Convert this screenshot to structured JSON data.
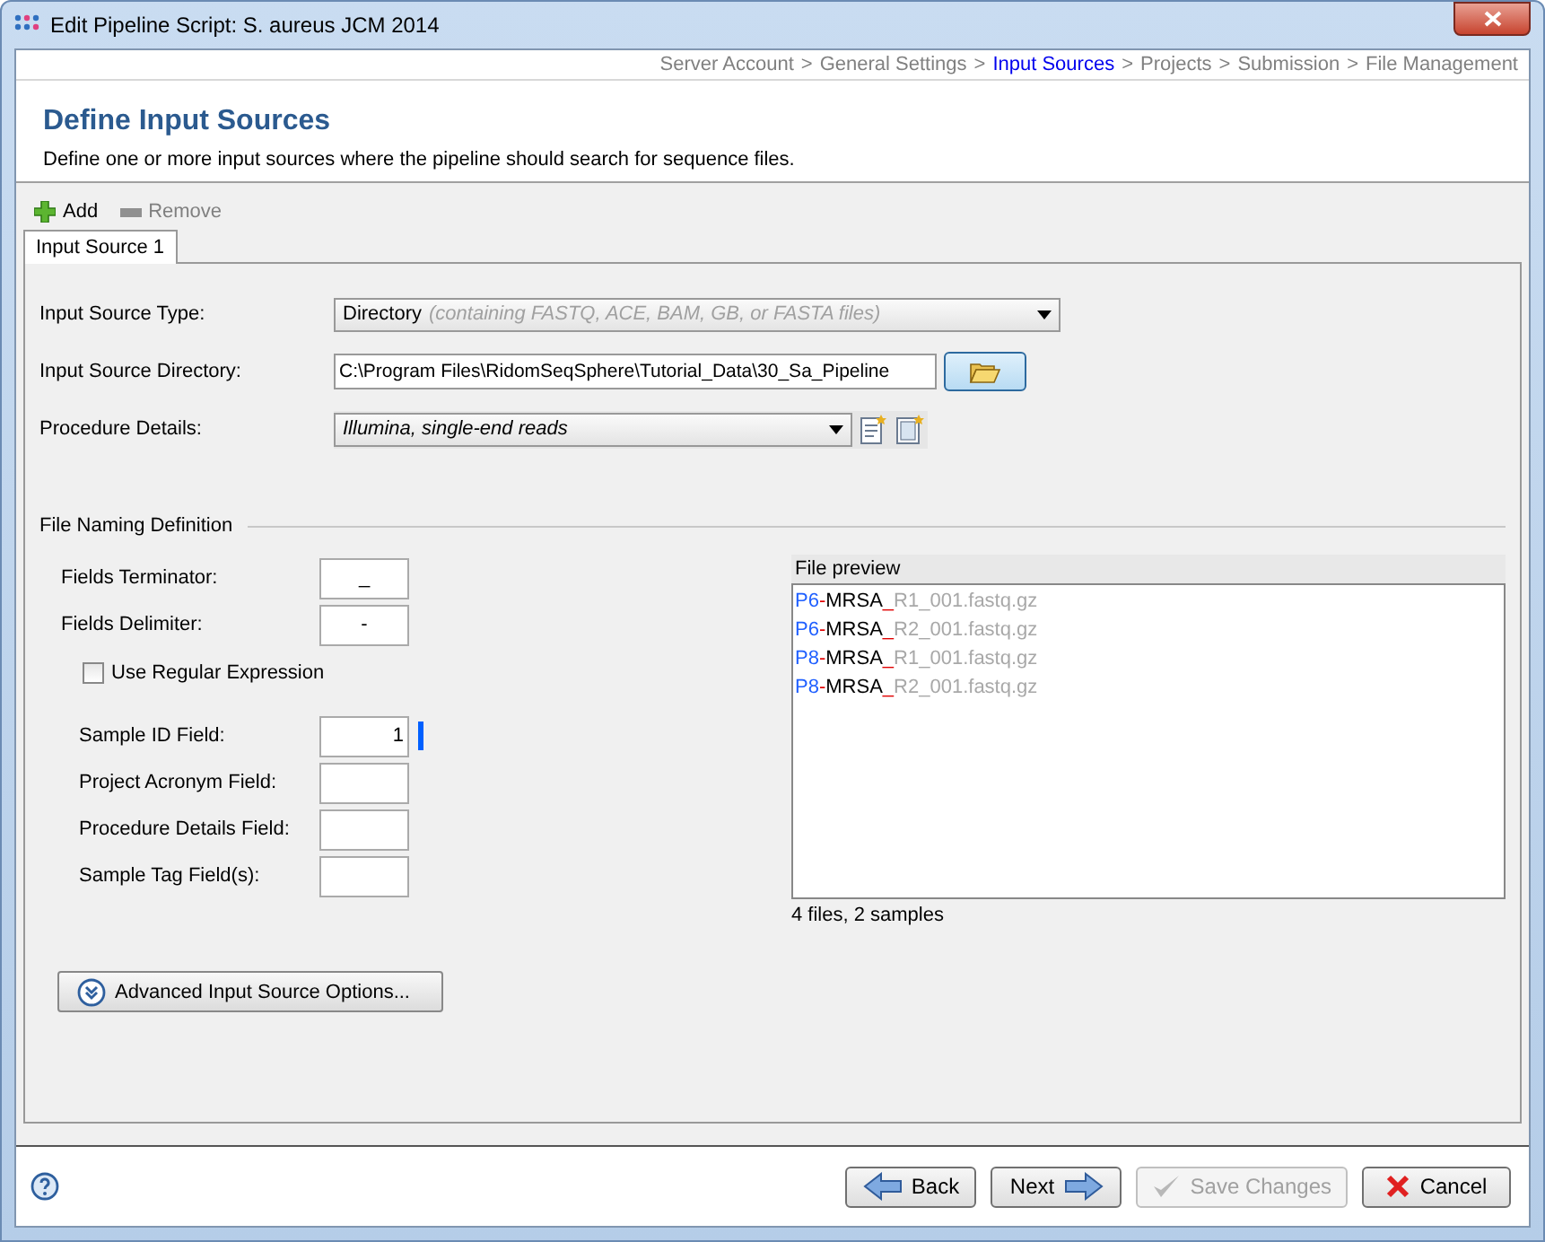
{
  "window": {
    "title": "Edit Pipeline Script: S. aureus JCM 2014"
  },
  "breadcrumb_separator": ">",
  "breadcrumb": [
    {
      "label": "Server Account",
      "selected": false
    },
    {
      "label": "General Settings",
      "selected": false
    },
    {
      "label": "Input Sources",
      "selected": true
    },
    {
      "label": "Projects",
      "selected": false
    },
    {
      "label": "Submission",
      "selected": false
    },
    {
      "label": "File Management",
      "selected": false
    }
  ],
  "header": {
    "title": "Define Input Sources",
    "description": "Define one or more input sources where the pipeline should search for sequence files."
  },
  "toolbar": [
    {
      "kind": "add",
      "label": "Add",
      "disabled": false
    },
    {
      "kind": "remove",
      "label": "Remove",
      "disabled": true
    }
  ],
  "tabs": [
    {
      "label": "Input Source 1",
      "selected": true
    }
  ],
  "source": {
    "type_label": "Input Source Type:",
    "type_value": "Directory",
    "type_hint": "(containing FASTQ, ACE, BAM, GB, or FASTA files)",
    "directory_label": "Input Source Directory:",
    "directory_value": "C:\\Program Files\\RidomSeqSphere\\Tutorial_Data\\30_Sa_Pipeline",
    "procedure_label": "Procedure Details:",
    "procedure_value": "Illumina, single-end reads"
  },
  "naming": {
    "title": "File Naming Definition",
    "separators": [
      {
        "label": "Fields Terminator:",
        "value": "_"
      },
      {
        "label": "Fields Delimiter:",
        "value": "-"
      }
    ],
    "regex": {
      "label": "Use Regular Expression",
      "checked": false
    },
    "fields": [
      {
        "label": "Sample ID Field:",
        "value": "1",
        "marked": true
      },
      {
        "label": "Project Acronym Field:",
        "marked": false
      },
      {
        "label": "Procedure Details Field:",
        "marked": false
      },
      {
        "label": "Sample Tag Field(s):",
        "marked": false
      }
    ],
    "advanced_button": "Advanced Input Source Options..."
  },
  "preview": {
    "title": "File preview",
    "rows": [
      [
        {
          "kind": "id",
          "text": "P6"
        },
        {
          "kind": "delimiter",
          "text": "-"
        },
        {
          "kind": "field",
          "text": "MRSA"
        },
        {
          "kind": "terminator",
          "text": "_"
        },
        {
          "kind": "rest",
          "text": "R1_001.fastq.gz"
        }
      ],
      [
        {
          "kind": "id",
          "text": "P6"
        },
        {
          "kind": "delimiter",
          "text": "-"
        },
        {
          "kind": "field",
          "text": "MRSA"
        },
        {
          "kind": "terminator",
          "text": "_"
        },
        {
          "kind": "rest",
          "text": "R2_001.fastq.gz"
        }
      ],
      [
        {
          "kind": "id",
          "text": "P8"
        },
        {
          "kind": "delimiter",
          "text": "-"
        },
        {
          "kind": "field",
          "text": "MRSA"
        },
        {
          "kind": "terminator",
          "text": "_"
        },
        {
          "kind": "rest",
          "text": "R1_001.fastq.gz"
        }
      ],
      [
        {
          "kind": "id",
          "text": "P8"
        },
        {
          "kind": "delimiter",
          "text": "-"
        },
        {
          "kind": "field",
          "text": "MRSA"
        },
        {
          "kind": "terminator",
          "text": "_"
        },
        {
          "kind": "rest",
          "text": "R2_001.fastq.gz"
        }
      ]
    ],
    "summary": "4 files, 2 samples"
  },
  "footer": [
    {
      "kind": "back",
      "label": "Back",
      "disabled": false
    },
    {
      "kind": "next",
      "label": "Next",
      "disabled": false
    },
    {
      "kind": "save",
      "label": "Save Changes",
      "disabled": true
    },
    {
      "kind": "cancel",
      "label": "Cancel",
      "disabled": false
    }
  ]
}
